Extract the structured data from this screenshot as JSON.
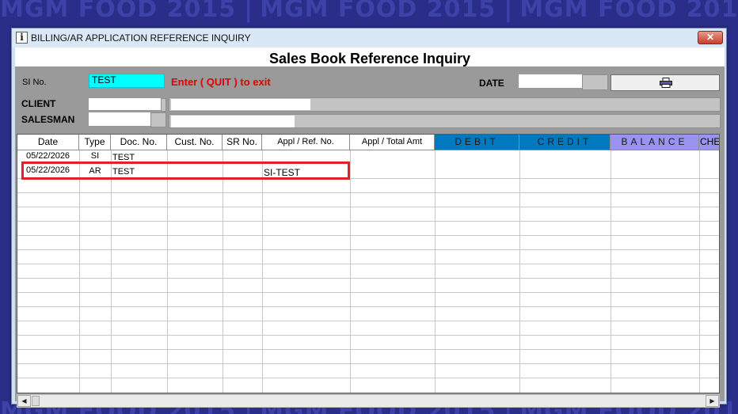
{
  "wallpaper": {
    "text": "MGM FOOD 2015"
  },
  "window": {
    "title": "BILLING/AR APPLICATION REFERENCE INQUIRY",
    "app_icon_glyph": "i",
    "close_glyph": "✕"
  },
  "form": {
    "heading": "Sales Book Reference Inquiry",
    "si_label": "SI No.",
    "si_value": "TEST",
    "hint": "Enter ( QUIT ) to exit",
    "date_label": "DATE",
    "date_value": "",
    "client_label": "CLIENT",
    "client_code": "",
    "client_name": "",
    "salesman_label": "SALESMAN",
    "salesman_code": "",
    "salesman_name": "",
    "print_icon": "printer-icon"
  },
  "table": {
    "columns": {
      "date": "Date",
      "type": "Type",
      "doc_no": "Doc. No.",
      "cust_no": "Cust. No.",
      "sr_no": "SR No.",
      "appl_ref": "Appl / Ref. No.",
      "appl_total": "Appl / Total Amt",
      "debit": "DEBIT",
      "credit": "CREDIT",
      "balance": "BALANCE",
      "che": "CHE"
    },
    "rows": [
      {
        "date": "05/22/2026",
        "type": "SI",
        "doc_no": "TEST",
        "cust_no": "",
        "sr_no": "",
        "appl_ref": "",
        "appl_total": "",
        "debit": "",
        "credit": "",
        "balance": ""
      },
      {
        "date": "05/22/2026",
        "type": "AR",
        "doc_no": "TEST",
        "cust_no": "",
        "sr_no": "",
        "appl_ref": "SI-TEST",
        "appl_total": "",
        "debit": "",
        "credit": "",
        "balance": ""
      }
    ]
  },
  "scrollbar": {
    "left_glyph": "◀",
    "right_glyph": "▶"
  },
  "colors": {
    "desktop": "#2a2e88",
    "si_field": "#00ffff",
    "hint_text": "#e00000",
    "debit_header": "#0079bf",
    "balance_header": "#9a93ef",
    "highlight_box": "#e0202a"
  }
}
